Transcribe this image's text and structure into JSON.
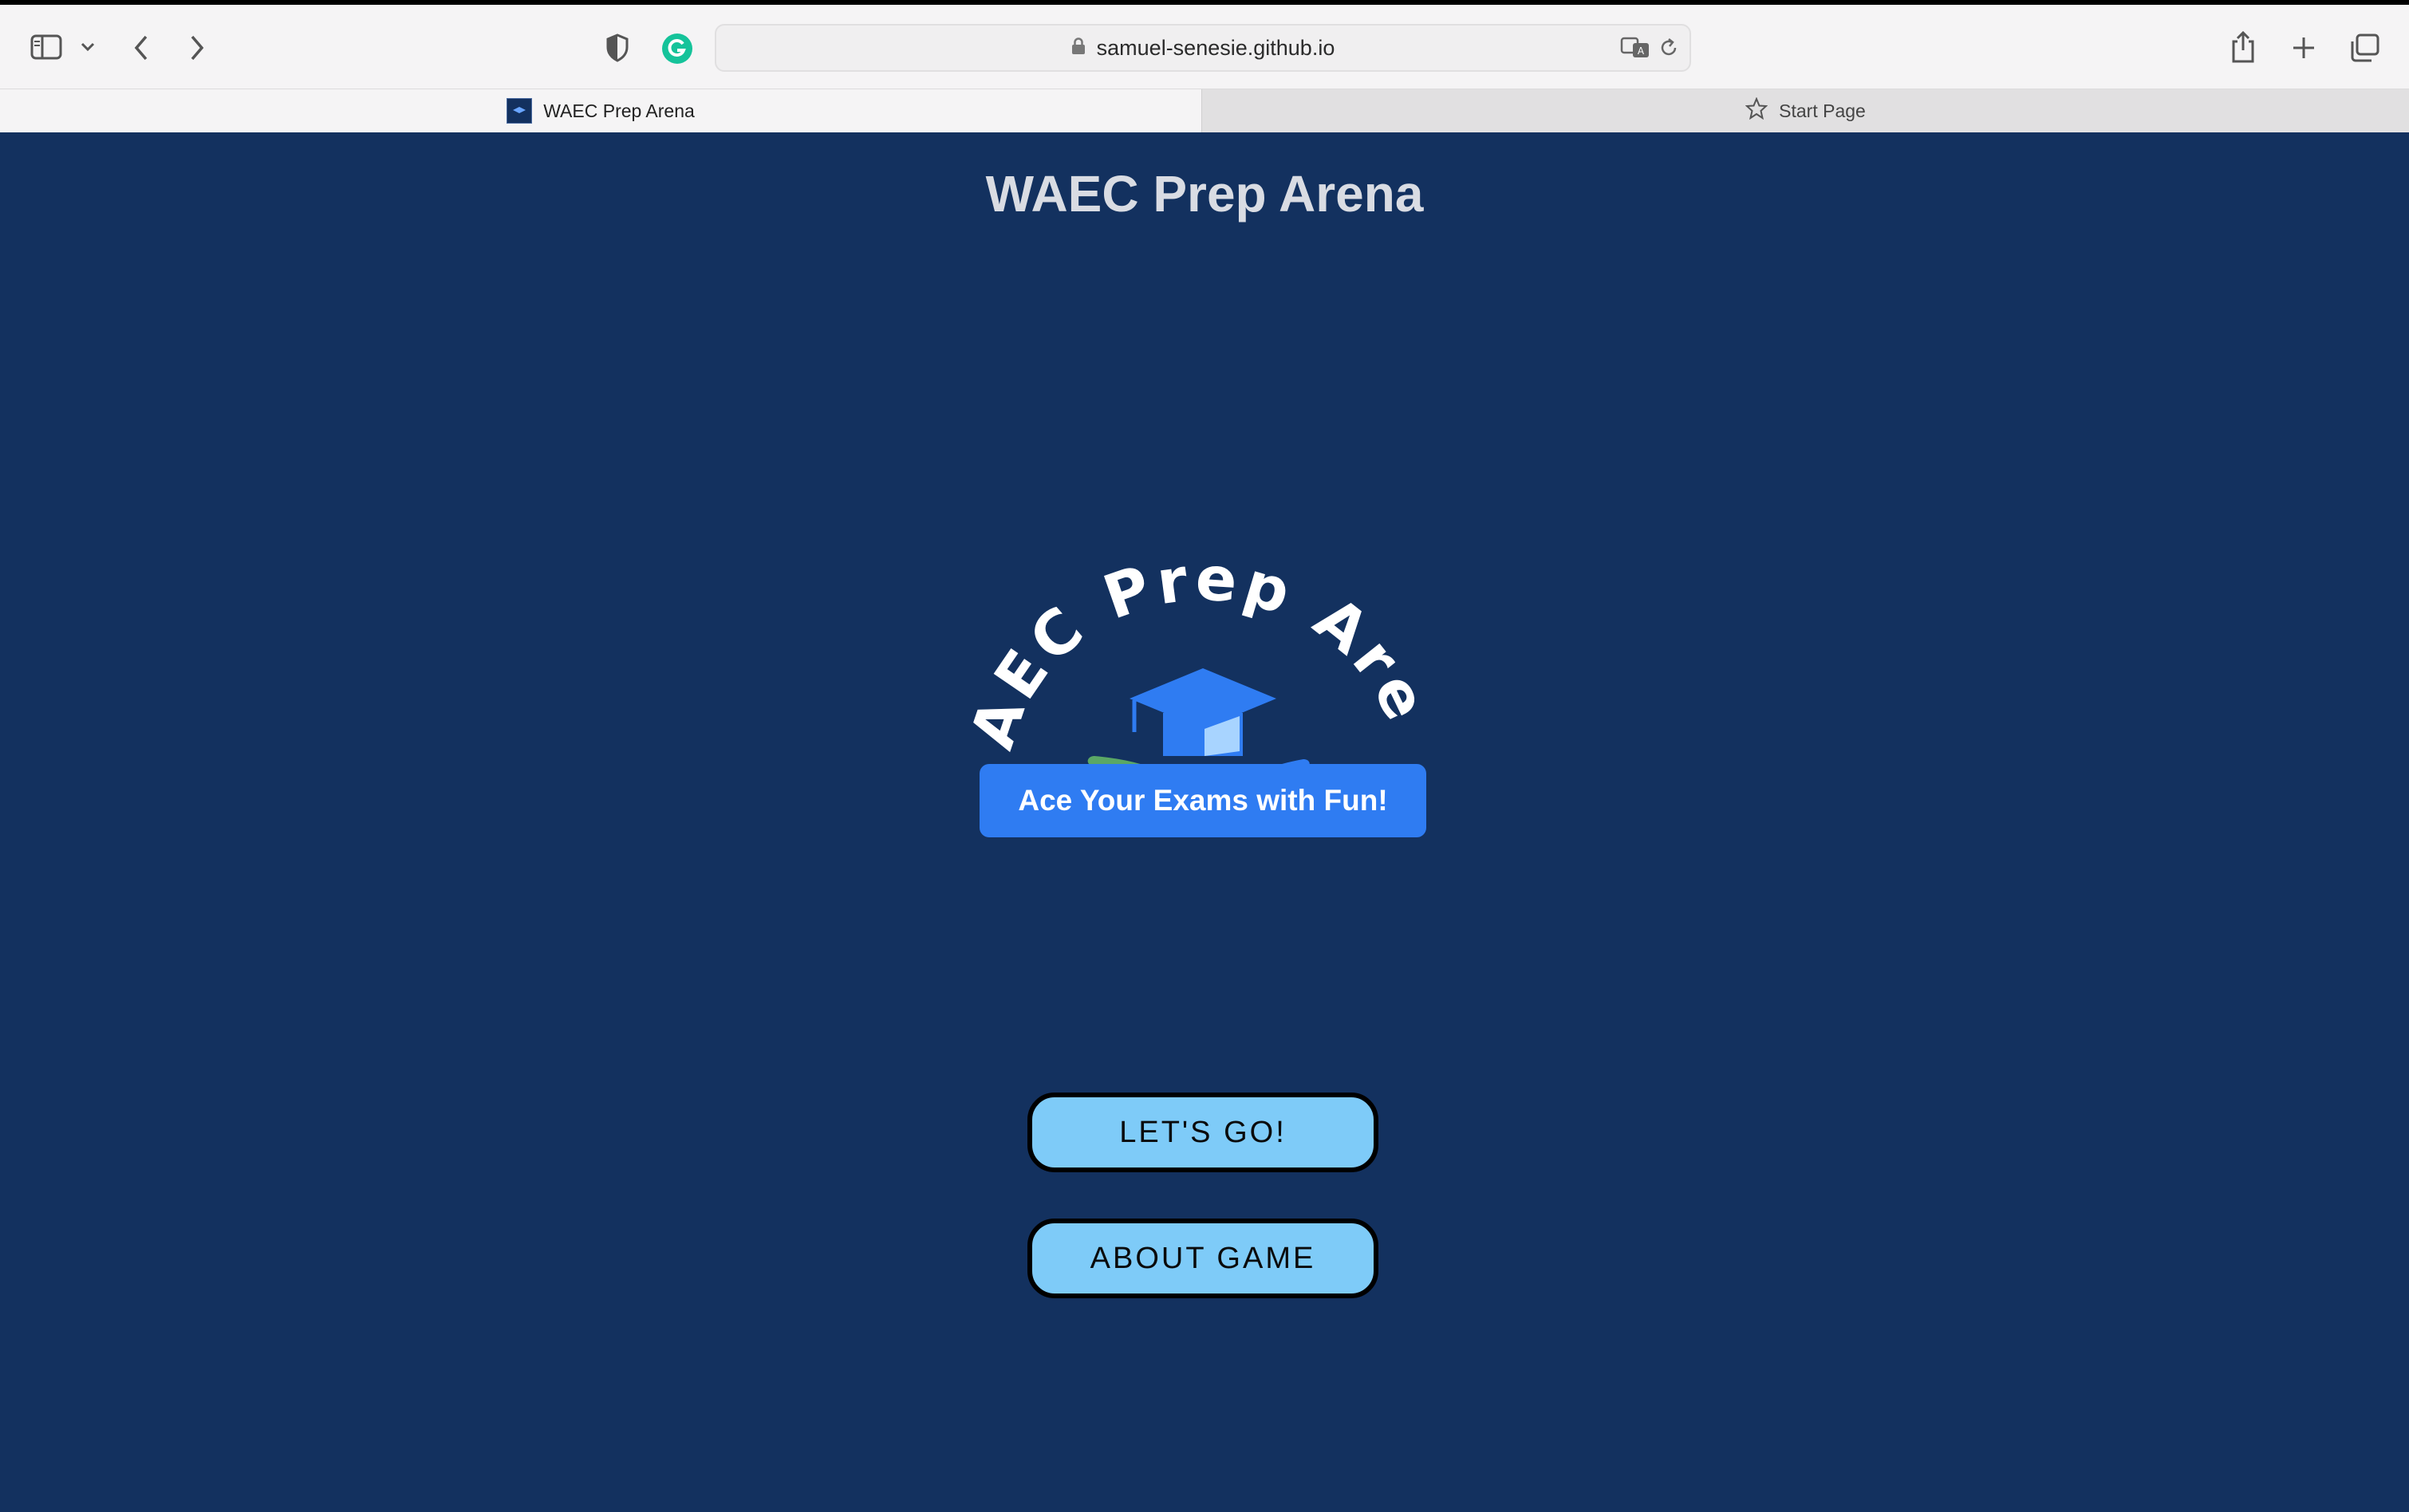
{
  "browser": {
    "url": "samuel-senesie.github.io",
    "tabs": [
      {
        "label": "WAEC Prep Arena",
        "active": true
      },
      {
        "label": "Start Page",
        "active": false
      }
    ]
  },
  "page": {
    "title": "WAEC Prep Arena",
    "logo": {
      "arc_text": "WAEC Prep Arena",
      "tagline": "Ace Your Exams with  Fun!"
    },
    "buttons": {
      "go": "LET'S GO!",
      "about": "ABOUT GAME"
    }
  },
  "colors": {
    "background": "#13315f",
    "button": "#7ecbf8",
    "accent": "#2f7cf2",
    "leaf_green": "#5aa765"
  }
}
